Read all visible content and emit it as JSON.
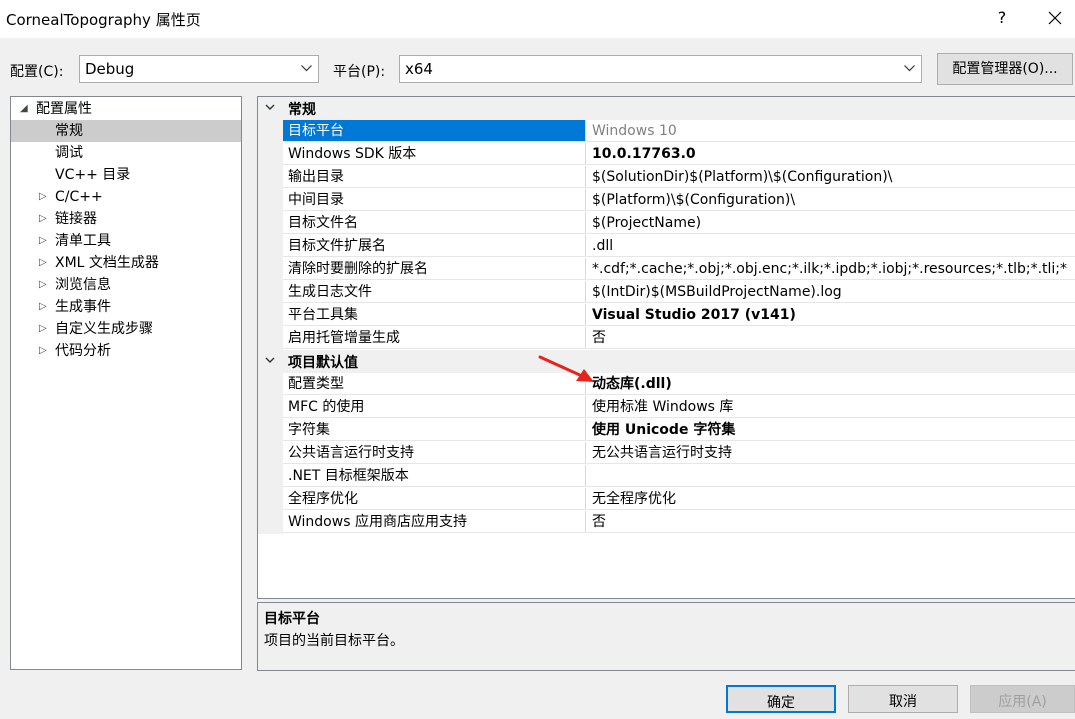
{
  "window": {
    "title": "CornealTopography 属性页",
    "help_label": "?"
  },
  "toolbar": {
    "config_label": "配置(C):",
    "config_value": "Debug",
    "platform_label": "平台(P):",
    "platform_value": "x64",
    "manager_button": "配置管理器(O)..."
  },
  "tree": {
    "items": [
      {
        "label": "配置属性",
        "expanded": true
      },
      {
        "label": "常规",
        "selected": true
      },
      {
        "label": "调试"
      },
      {
        "label": "VC++ 目录"
      },
      {
        "label": "C/C++",
        "collapsed": true
      },
      {
        "label": "链接器",
        "collapsed": true
      },
      {
        "label": "清单工具",
        "collapsed": true
      },
      {
        "label": "XML 文档生成器",
        "collapsed": true
      },
      {
        "label": "浏览信息",
        "collapsed": true
      },
      {
        "label": "生成事件",
        "collapsed": true
      },
      {
        "label": "自定义生成步骤",
        "collapsed": true
      },
      {
        "label": "代码分析",
        "collapsed": true
      }
    ]
  },
  "grid": {
    "sections": [
      {
        "title": "常规",
        "rows": [
          {
            "name": "目标平台",
            "value": "Windows 10"
          },
          {
            "name": "Windows SDK 版本",
            "value": "10.0.17763.0"
          },
          {
            "name": "输出目录",
            "value": "$(SolutionDir)$(Platform)\\$(Configuration)\\"
          },
          {
            "name": "中间目录",
            "value": "$(Platform)\\$(Configuration)\\"
          },
          {
            "name": "目标文件名",
            "value": "$(ProjectName)"
          },
          {
            "name": "目标文件扩展名",
            "value": ".dll"
          },
          {
            "name": "清除时要删除的扩展名",
            "value": "*.cdf;*.cache;*.obj;*.obj.enc;*.ilk;*.ipdb;*.iobj;*.resources;*.tlb;*.tli;*"
          },
          {
            "name": "生成日志文件",
            "value": "$(IntDir)$(MSBuildProjectName).log"
          },
          {
            "name": "平台工具集",
            "value": "Visual Studio 2017 (v141)"
          },
          {
            "name": "启用托管增量生成",
            "value": "否"
          }
        ]
      },
      {
        "title": "项目默认值",
        "rows": [
          {
            "name": "配置类型",
            "value": "动态库(.dll)"
          },
          {
            "name": "MFC 的使用",
            "value": "使用标准 Windows 库"
          },
          {
            "name": "字符集",
            "value": "使用 Unicode 字符集"
          },
          {
            "name": "公共语言运行时支持",
            "value": "无公共语言运行时支持"
          },
          {
            "name": ".NET 目标框架版本",
            "value": ""
          },
          {
            "name": "全程序优化",
            "value": "无全程序优化"
          },
          {
            "name": "Windows 应用商店应用支持",
            "value": "否"
          }
        ]
      }
    ]
  },
  "description": {
    "title": "目标平台",
    "text": "项目的当前目标平台。"
  },
  "buttons": {
    "ok": "确定",
    "cancel": "取消",
    "apply": "应用(A)"
  },
  "colors": {
    "selection": "#0078d7",
    "annotation_arrow": "#e8231b"
  }
}
